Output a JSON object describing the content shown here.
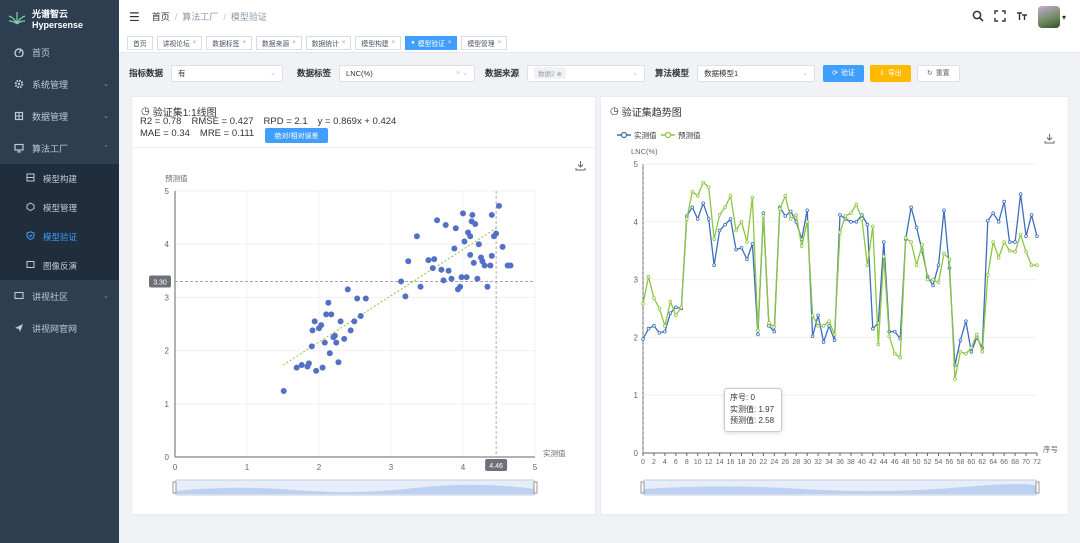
{
  "app": {
    "name": "光谱智云Hypersense"
  },
  "sidebar": {
    "items": [
      {
        "label": "首页",
        "icon": "dashboard-icon"
      },
      {
        "label": "系统管理",
        "icon": "gear-icon"
      },
      {
        "label": "数据管理",
        "icon": "database-icon"
      },
      {
        "label": "算法工厂",
        "icon": "monitor-icon",
        "children": [
          {
            "label": "模型构建",
            "icon": "grid-icon"
          },
          {
            "label": "模型管理",
            "icon": "cube-icon"
          },
          {
            "label": "模型验证",
            "icon": "shield-icon",
            "active": true
          },
          {
            "label": "图像反演",
            "icon": "image-icon"
          }
        ]
      },
      {
        "label": "讲视社区",
        "icon": "chat-icon"
      },
      {
        "label": "讲视网官网",
        "icon": "send-icon"
      }
    ]
  },
  "breadcrumb": [
    "首页",
    "算法工厂",
    "模型验证"
  ],
  "tags": [
    {
      "label": "首页",
      "closable": false
    },
    {
      "label": "讲视论坛",
      "closable": true
    },
    {
      "label": "数据标签",
      "closable": true
    },
    {
      "label": "数据来源",
      "closable": true
    },
    {
      "label": "数据统计",
      "closable": true
    },
    {
      "label": "模型构建",
      "closable": true
    },
    {
      "label": "模型验证",
      "closable": true,
      "active": true
    },
    {
      "label": "模型管理",
      "closable": true
    }
  ],
  "filters": {
    "indicator_label": "指标数据",
    "indicator_value": "有",
    "tag_label": "数据标签",
    "tag_value": "LNC(%)",
    "source_label": "数据来源",
    "source_chip": "数据2 ⊗",
    "model_label": "算法模型",
    "model_value": "数据模型1",
    "verify_btn": "验证",
    "export_btn": "导出",
    "reset_btn": "重置"
  },
  "left_panel": {
    "title": "验证集1:1线图",
    "stats_line1": [
      "R2 = 0.78",
      "RMSE = 0.427",
      "RPD = 2.1",
      "y = 0.869x + 0.424"
    ],
    "stats_line2": [
      "MAE = 0.34",
      "MRE = 0.111"
    ],
    "error_button": "绝对/相对误差"
  },
  "right_panel": {
    "title": "验证集趋势图"
  },
  "colors": {
    "primary": "#409eff",
    "sidebar": "#2c3e50",
    "scatter": "#5470c6",
    "actual": "#3e6dbe",
    "predicted": "#8dc63f",
    "warn": "#ffba00"
  },
  "chart_data": [
    {
      "type": "scatter",
      "xlabel": "实测值",
      "ylabel": "预测值",
      "xlim": [
        0,
        5
      ],
      "ylim": [
        0,
        5
      ],
      "x_ticks": [
        "0",
        "1",
        "2",
        "3",
        "4",
        "5"
      ],
      "y_ticks": [
        "0",
        "1",
        "2",
        "3",
        "4",
        "5"
      ],
      "crosshair": {
        "x_label": "4.46",
        "y_label": "3.30",
        "x": 4.46,
        "y": 3.3
      },
      "fit_line": {
        "slope": 0.869,
        "intercept": 0.424,
        "x_range": [
          1.5,
          4.46
        ]
      },
      "points": [
        [
          1.51,
          1.24
        ],
        [
          1.69,
          1.68
        ],
        [
          1.76,
          1.73
        ],
        [
          1.84,
          1.7
        ],
        [
          1.86,
          1.76
        ],
        [
          1.9,
          2.08
        ],
        [
          1.91,
          2.38
        ],
        [
          1.94,
          2.55
        ],
        [
          1.96,
          1.62
        ],
        [
          2.0,
          2.42
        ],
        [
          2.03,
          2.48
        ],
        [
          2.05,
          1.68
        ],
        [
          2.08,
          2.15
        ],
        [
          2.1,
          2.68
        ],
        [
          2.13,
          2.9
        ],
        [
          2.15,
          1.95
        ],
        [
          2.17,
          2.68
        ],
        [
          2.2,
          2.25
        ],
        [
          2.22,
          2.28
        ],
        [
          2.24,
          2.15
        ],
        [
          2.27,
          1.78
        ],
        [
          2.3,
          2.55
        ],
        [
          2.35,
          2.22
        ],
        [
          2.4,
          3.15
        ],
        [
          2.44,
          2.38
        ],
        [
          2.49,
          2.55
        ],
        [
          2.53,
          2.98
        ],
        [
          2.58,
          2.65
        ],
        [
          2.65,
          2.98
        ],
        [
          3.14,
          3.3
        ],
        [
          3.2,
          3.02
        ],
        [
          3.24,
          3.68
        ],
        [
          3.36,
          4.15
        ],
        [
          3.41,
          3.2
        ],
        [
          3.52,
          3.7
        ],
        [
          3.58,
          3.55
        ],
        [
          3.6,
          3.72
        ],
        [
          3.64,
          4.45
        ],
        [
          3.7,
          3.52
        ],
        [
          3.73,
          3.32
        ],
        [
          3.76,
          4.36
        ],
        [
          3.8,
          3.5
        ],
        [
          3.84,
          3.35
        ],
        [
          3.88,
          3.92
        ],
        [
          3.9,
          4.3
        ],
        [
          3.93,
          3.15
        ],
        [
          3.96,
          3.2
        ],
        [
          3.98,
          3.38
        ],
        [
          4.0,
          4.58
        ],
        [
          4.02,
          4.05
        ],
        [
          4.05,
          3.38
        ],
        [
          4.07,
          4.22
        ],
        [
          4.1,
          3.8
        ],
        [
          4.12,
          4.43
        ],
        [
          4.13,
          4.55
        ],
        [
          4.15,
          3.65
        ],
        [
          4.17,
          4.38
        ],
        [
          4.2,
          3.35
        ],
        [
          4.22,
          4.0
        ],
        [
          4.25,
          3.75
        ],
        [
          4.27,
          3.68
        ],
        [
          4.3,
          3.6
        ],
        [
          4.34,
          3.2
        ],
        [
          4.38,
          3.6
        ],
        [
          4.4,
          4.55
        ],
        [
          4.43,
          4.15
        ],
        [
          4.46,
          4.2
        ],
        [
          4.5,
          4.72
        ],
        [
          4.55,
          3.95
        ],
        [
          4.62,
          3.6
        ],
        [
          4.66,
          3.6
        ],
        [
          4.4,
          3.78
        ],
        [
          4.1,
          4.15
        ]
      ]
    },
    {
      "type": "line",
      "xlabel": "序号",
      "ylabel": "LNC(%)",
      "ylim": [
        0,
        5
      ],
      "y_ticks": [
        "0",
        "1",
        "2",
        "3",
        "4",
        "5"
      ],
      "x_ticks": [
        "0",
        "2",
        "4",
        "6",
        "8",
        "10",
        "12",
        "14",
        "16",
        "18",
        "20",
        "22",
        "24",
        "26",
        "28",
        "30",
        "32",
        "34",
        "36",
        "38",
        "40",
        "42",
        "44",
        "46",
        "48",
        "50",
        "52",
        "54",
        "56",
        "58",
        "60",
        "62",
        "64",
        "66",
        "68",
        "70",
        "72"
      ],
      "series": [
        {
          "name": "实测值",
          "values": [
            1.97,
            2.15,
            2.2,
            2.08,
            2.1,
            2.42,
            2.52,
            2.5,
            4.1,
            4.25,
            4.05,
            4.32,
            4.05,
            3.25,
            3.85,
            3.95,
            4.05,
            3.52,
            3.55,
            3.35,
            3.62,
            2.05,
            4.15,
            2.2,
            2.1,
            4.25,
            4.1,
            4.18,
            4.0,
            3.7,
            4.2,
            2.02,
            2.38,
            1.92,
            2.2,
            1.95,
            4.12,
            4.05,
            4.0,
            4.0,
            4.12,
            3.95,
            2.15,
            2.25,
            3.65,
            2.1,
            2.1,
            1.98,
            3.7,
            4.25,
            3.9,
            3.5,
            3.05,
            2.9,
            3.25,
            4.2,
            3.2,
            1.52,
            1.95,
            2.28,
            1.75,
            2.0,
            1.82,
            4.02,
            4.15,
            4.0,
            4.35,
            3.65,
            3.65,
            4.48,
            3.75,
            4.12,
            3.75
          ]
        },
        {
          "name": "预测值",
          "values": [
            2.58,
            3.05,
            2.68,
            2.5,
            2.2,
            2.62,
            2.38,
            2.52,
            4.05,
            4.52,
            4.45,
            4.68,
            4.6,
            3.7,
            4.12,
            4.25,
            4.45,
            3.85,
            4.0,
            3.65,
            4.42,
            2.12,
            4.1,
            2.25,
            2.18,
            4.22,
            4.45,
            4.05,
            4.12,
            3.58,
            4.0,
            2.38,
            2.2,
            2.2,
            2.28,
            2.05,
            3.82,
            4.1,
            4.15,
            4.3,
            4.05,
            3.25,
            3.92,
            1.88,
            3.4,
            2.02,
            1.72,
            1.65,
            3.72,
            3.65,
            3.25,
            3.6,
            3.0,
            3.0,
            2.95,
            3.45,
            3.35,
            1.28,
            1.75,
            1.72,
            1.82,
            2.05,
            1.75,
            3.08,
            3.65,
            3.38,
            3.65,
            3.5,
            3.48,
            3.78,
            3.48,
            3.25,
            3.25
          ]
        }
      ],
      "tooltip": {
        "index_label": "序号: 0",
        "actual_label": "实测值: 1.97",
        "predicted_label": "预测值: 2.58"
      }
    }
  ]
}
